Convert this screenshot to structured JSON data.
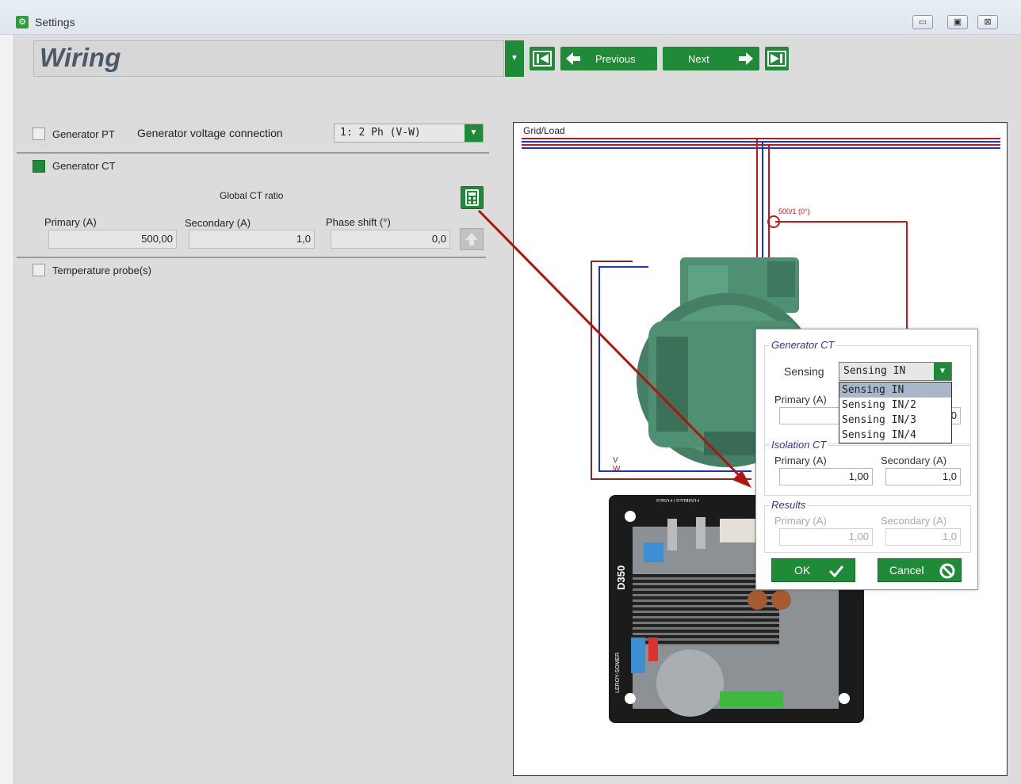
{
  "window": {
    "title": "Settings",
    "controls": {
      "minimize": "▭",
      "restore": "▣",
      "close": "⊠"
    }
  },
  "header": {
    "page_title": "Wiring",
    "previous_label": "Previous",
    "next_label": "Next"
  },
  "generator_pt": {
    "label": "Generator PT",
    "checked": false,
    "connection_label": "Generator voltage connection",
    "connection_value": "1: 2 Ph (V-W)"
  },
  "generator_ct": {
    "label": "Generator CT",
    "checked": true,
    "global_ratio_label": "Global CT ratio",
    "primary_label": "Primary (A)",
    "primary_value": "500,00",
    "secondary_label": "Secondary (A)",
    "secondary_value": "1,0",
    "phase_shift_label": "Phase shift (°)",
    "phase_shift_value": "0,0"
  },
  "temperature": {
    "label": "Temperature probe(s)",
    "checked": false
  },
  "diagram": {
    "grid_label": "Grid/Load",
    "ct_label": "500/1 (0°)",
    "v_label": "V",
    "w_label": "W",
    "board_label": "D350",
    "brand_label": "LEROY-SOMER",
    "fuses_label": "FUSIBLES / FUSES"
  },
  "dialog": {
    "generator_ct_title": "Generator CT",
    "sensing_label": "Sensing",
    "sensing_value": "Sensing IN",
    "sensing_options": [
      "Sensing IN",
      "Sensing IN/2",
      "Sensing IN/3",
      "Sensing IN/4"
    ],
    "primary_label": "Primary (A)",
    "primary_value_partial": "5",
    "secondary_value_partial": "0",
    "isolation_title": "Isolation CT",
    "iso_primary_label": "Primary (A)",
    "iso_primary_value": "1,00",
    "iso_secondary_label": "Secondary (A)",
    "iso_secondary_value": "1,0",
    "results_title": "Results",
    "res_primary_label": "Primary (A)",
    "res_primary_value": "1,00",
    "res_secondary_label": "Secondary (A)",
    "res_secondary_value": "1,0",
    "ok_label": "OK",
    "cancel_label": "Cancel"
  },
  "colors": {
    "accent_green": "#1f8a37",
    "wire_red": "#c51717",
    "wire_blue": "#1a33d6",
    "arrow_red": "#b3120f",
    "generator_green": "#4f8f72"
  }
}
